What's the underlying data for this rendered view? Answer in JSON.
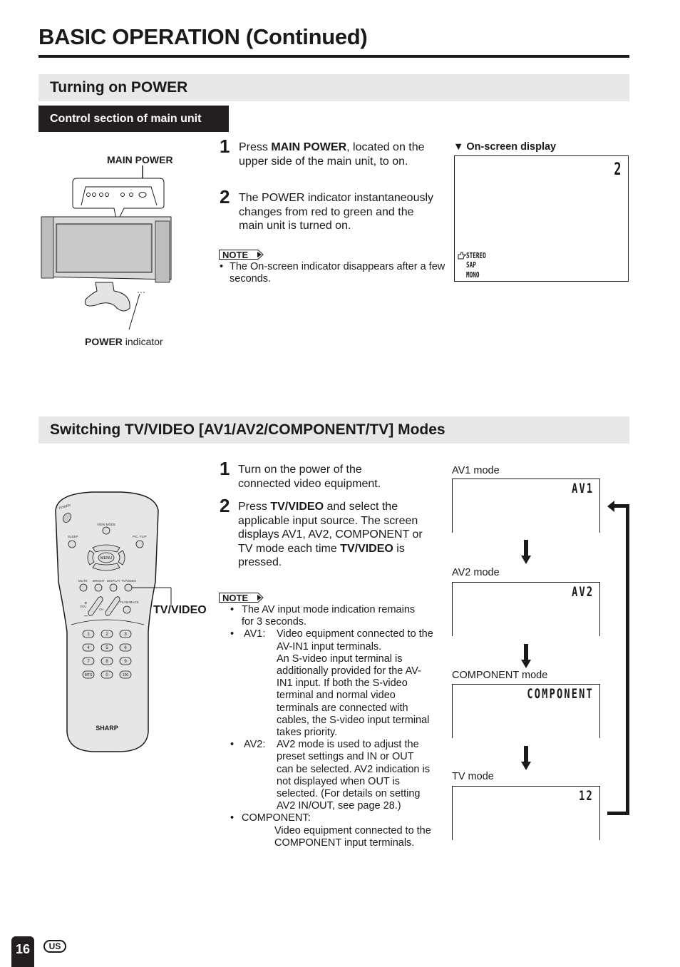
{
  "page": {
    "title": "BASIC OPERATION (Continued)",
    "page_number": "16",
    "region": "US"
  },
  "power_section": {
    "heading": "Turning on POWER",
    "subheading": "Control section of main unit",
    "illustration": {
      "main_power_label": "MAIN POWER",
      "power_indicator_bold": "POWER",
      "power_indicator_rest": " indicator"
    },
    "steps": [
      {
        "number": "1",
        "pre": "Press ",
        "bold": "MAIN POWER",
        "post": ", located on the upper side of the main unit, to on."
      },
      {
        "number": "2",
        "text": "The POWER indicator instantaneously changes from red to green and the main unit is turned on."
      }
    ],
    "note_label": "NOTE",
    "notes": [
      "The On-screen indicator disappears after a few seconds."
    ],
    "osd": {
      "caption": "On-screen display",
      "channel": "2",
      "audio_options": [
        "STEREO",
        "SAP",
        "MONO"
      ],
      "selected_audio": "STEREO"
    }
  },
  "video_section": {
    "heading": "Switching TV/VIDEO [AV1/AV2/COMPONENT/TV] Modes",
    "callout_label": "TV/VIDEO",
    "remote": {
      "brand": "SHARP",
      "buttons": {
        "power": "POWER",
        "view_mode": "VIEW MODE",
        "sleep": "SLEEP",
        "pic_flip": "PIC. FLIP",
        "menu": "MENU",
        "mute": "MUTE",
        "bright": "BRIGHT",
        "display": "DISPLAY",
        "tv_video": "TV/VIDEO",
        "vol": "VOL",
        "ch": "CH",
        "flashback": "FLASHBACK",
        "keypad": [
          "1",
          "2",
          "3",
          "4",
          "5",
          "6",
          "7",
          "8",
          "9",
          "MTS",
          "0",
          "100"
        ]
      }
    },
    "steps": [
      {
        "number": "1",
        "text": "Turn on the power of the connected video equipment."
      },
      {
        "number": "2",
        "pre": "Press ",
        "bold1": "TV/VIDEO",
        "mid": " and select the applicable input source. The screen displays AV1, AV2, COMPONENT or TV mode each time ",
        "bold2": "TV/VIDEO",
        "post": " is pressed."
      }
    ],
    "note_label": "NOTE",
    "notes": [
      {
        "term": "",
        "lines": [
          "The AV input mode indication remains",
          "for 3 seconds."
        ]
      },
      {
        "term": "AV1:",
        "lines": [
          "Video equipment connected to the",
          "AV-IN1 input terminals.",
          "An S-video input terminal is",
          "additionally provided for the AV-",
          "IN1 input. If both the S-video",
          "terminal and normal video",
          "terminals are connected with",
          "cables, the S-video input terminal",
          "takes priority."
        ]
      },
      {
        "term": "AV2:",
        "lines": [
          "AV2 mode is used to adjust the",
          "preset settings and IN or OUT",
          "can be selected. AV2 indication is",
          "not displayed when OUT is",
          "selected. (For details on setting",
          "AV2 IN/OUT, see page 28.)"
        ]
      },
      {
        "term": "COMPONENT:",
        "lines": [
          "Video equipment connected to the",
          "COMPONENT input terminals."
        ]
      }
    ],
    "modes": [
      {
        "label": "AV1 mode",
        "display": "AV1"
      },
      {
        "label": "AV2 mode",
        "display": "AV2"
      },
      {
        "label": "COMPONENT mode",
        "display": "COMPONENT"
      },
      {
        "label": "TV mode",
        "display": "12"
      }
    ]
  }
}
